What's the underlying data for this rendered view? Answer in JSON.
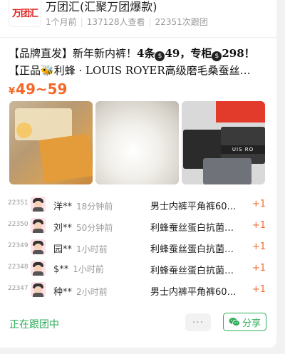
{
  "header": {
    "logo_text": "万团汇",
    "group_name": "万团汇(汇聚万团爆款)",
    "posted": "1个月前",
    "views": "137128人查看",
    "follows": "22351次跟团"
  },
  "product": {
    "title_line1_a": "【品牌直发】新年新内裤！",
    "title_line1_b": "4条",
    "title_line1_c": "49，专柜",
    "title_line1_d": "298！",
    "title_line2": "【正品",
    "title_line2_b": "利蜂 · LOUIS ROYER高级磨毛桑蚕丝…",
    "coin_symbol": "$",
    "bee_emoji": "🐝",
    "price_symbol": "¥",
    "price_range": "49~59"
  },
  "images": [
    {
      "name": "gift-box-photo"
    },
    {
      "name": "fabric-closeup-photo"
    },
    {
      "name": "underwear-stack-photo",
      "waistband_text": "UIS RO"
    }
  ],
  "followers": [
    {
      "num": "22351",
      "name": "洋**",
      "time": "18分钟前",
      "product": "男士内裤平角裤60…",
      "qty": "+1"
    },
    {
      "num": "22350",
      "name": "刘**",
      "time": "50分钟前",
      "product": "利蜂蚕丝蛋白抗菌…",
      "qty": "+1"
    },
    {
      "num": "22349",
      "name": "园**",
      "time": "1小时前",
      "product": "利蜂蚕丝蛋白抗菌…",
      "qty": "+1"
    },
    {
      "num": "22348",
      "name": "$**",
      "time": "1小时前",
      "product": "利蜂蚕丝蛋白抗菌…",
      "qty": "+1"
    },
    {
      "num": "22347",
      "name": "种**",
      "time": "2小时前",
      "product": "男士内裤平角裤60…",
      "qty": "+1"
    }
  ],
  "footer": {
    "status": "正在跟团中",
    "more_label": "···",
    "share_label": "分享"
  },
  "colors": {
    "accent_orange": "#f5682a",
    "accent_green": "#2fae5a",
    "logo_red": "#e02020"
  }
}
